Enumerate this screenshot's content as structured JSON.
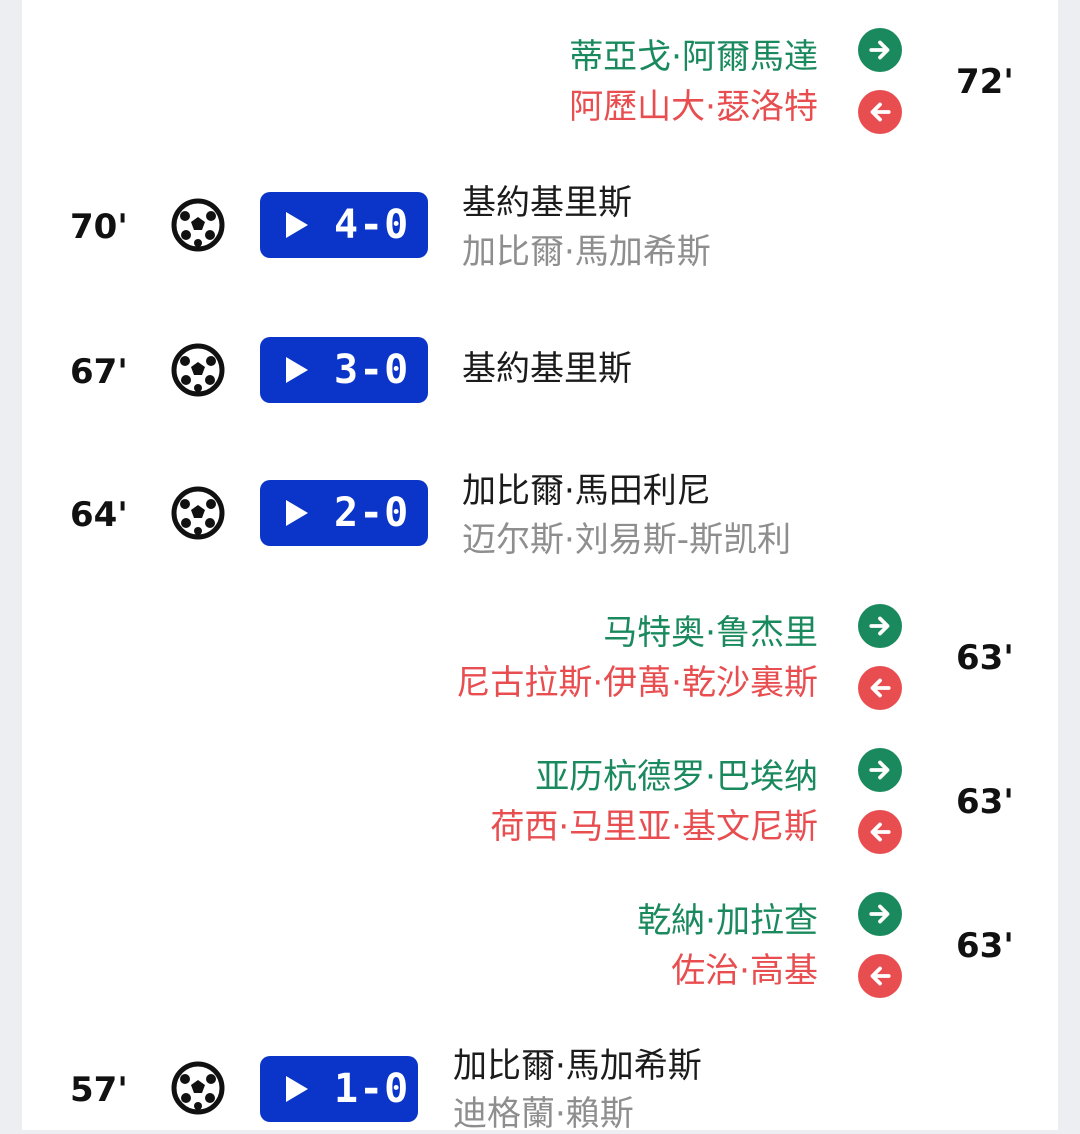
{
  "events": [
    {
      "type": "sub",
      "in": "蒂亞戈·阿爾馬達",
      "out": "阿歷山大·瑟洛特",
      "minute": "72'"
    },
    {
      "type": "goal",
      "minute": "70'",
      "score": "4-0",
      "scorer": "基約基里斯",
      "assist": "加比爾·馬加希斯"
    },
    {
      "type": "goal",
      "minute": "67'",
      "score": "3-0",
      "scorer": "基約基里斯",
      "assist": ""
    },
    {
      "type": "goal",
      "minute": "64'",
      "score": "2-0",
      "scorer": "加比爾·馬田利尼",
      "assist": "迈尔斯·刘易斯-斯凯利"
    },
    {
      "type": "sub",
      "in": "马特奥·鲁杰里",
      "out": "尼古拉斯·伊萬·乾沙裏斯",
      "minute": "63'"
    },
    {
      "type": "sub",
      "in": "亚历杭德罗·巴埃纳",
      "out": "荷西·马里亚·基文尼斯",
      "minute": "63'"
    },
    {
      "type": "sub",
      "in": "乾納·加拉查",
      "out": "佐治·高基",
      "minute": "63'"
    },
    {
      "type": "goal",
      "minute": "57'",
      "score": "1-0",
      "scorer": "加比爾·馬加希斯",
      "assist": "迪格蘭·賴斯"
    }
  ],
  "icons": {
    "sub_in": "arrow-right-icon",
    "sub_out": "arrow-left-icon",
    "goal": "soccer-ball-icon",
    "video": "play-icon"
  },
  "colors": {
    "sub_in": "#1a8a5e",
    "sub_out": "#e84d50",
    "video_button": "#0a35c8",
    "assist_text": "#8e8e8e"
  }
}
